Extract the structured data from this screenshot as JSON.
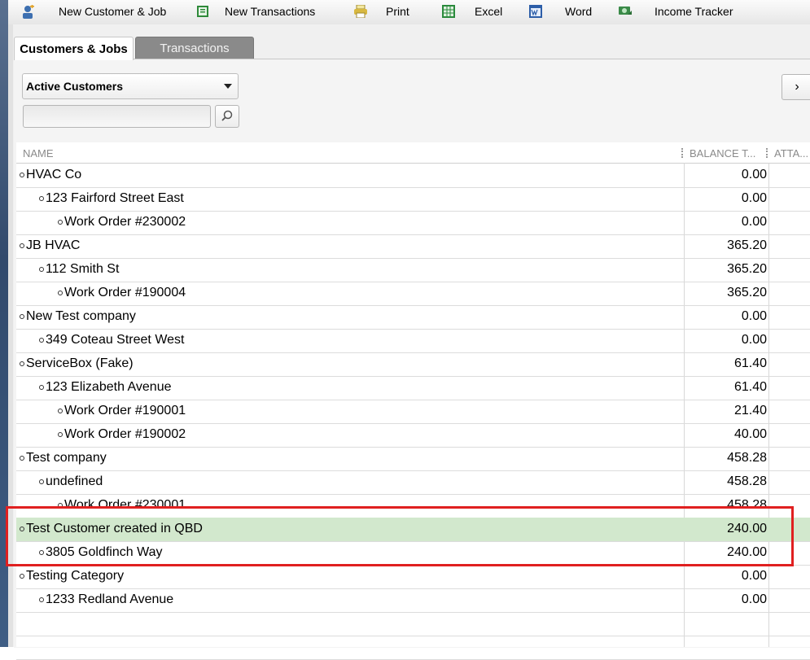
{
  "toolbar": {
    "new_customer_job": "New Customer & Job",
    "new_transactions": "New Transactions",
    "print": "Print",
    "excel": "Excel",
    "word": "Word",
    "income_tracker": "Income Tracker"
  },
  "tabs": {
    "customers_jobs": "Customers & Jobs",
    "transactions": "Transactions"
  },
  "filter": {
    "selected": "Active Customers"
  },
  "search": {
    "value": ""
  },
  "columns": {
    "name": "NAME",
    "balance": "BALANCE T...",
    "attach": "ATTA..."
  },
  "rows": [
    {
      "name": "HVAC Co",
      "balance": "0.00"
    },
    {
      "name": "123 Fairford Street East",
      "balance": "0.00"
    },
    {
      "name": "Work Order #230002",
      "balance": "0.00"
    },
    {
      "name": "JB HVAC",
      "balance": "365.20"
    },
    {
      "name": "112 Smith St",
      "balance": "365.20"
    },
    {
      "name": "Work Order #190004",
      "balance": "365.20"
    },
    {
      "name": "New Test company",
      "balance": "0.00"
    },
    {
      "name": "349 Coteau Street West",
      "balance": "0.00"
    },
    {
      "name": "ServiceBox (Fake)",
      "balance": "61.40"
    },
    {
      "name": "123 Elizabeth Avenue",
      "balance": "61.40"
    },
    {
      "name": "Work Order #190001",
      "balance": "21.40"
    },
    {
      "name": "Work Order #190002",
      "balance": "40.00"
    },
    {
      "name": "Test company",
      "balance": "458.28"
    },
    {
      "name": "undefined",
      "balance": "458.28"
    },
    {
      "name": "Work Order #230001",
      "balance": "458.28"
    },
    {
      "name": "Test Customer created in QBD",
      "balance": "240.00"
    },
    {
      "name": "3805 Goldfinch Way",
      "balance": "240.00"
    },
    {
      "name": "Testing Category",
      "balance": "0.00"
    },
    {
      "name": "1233 Redland Avenue",
      "balance": "0.00"
    }
  ],
  "colors": {
    "selected_row": "#d2e8cd",
    "highlight_box": "#e02020"
  }
}
